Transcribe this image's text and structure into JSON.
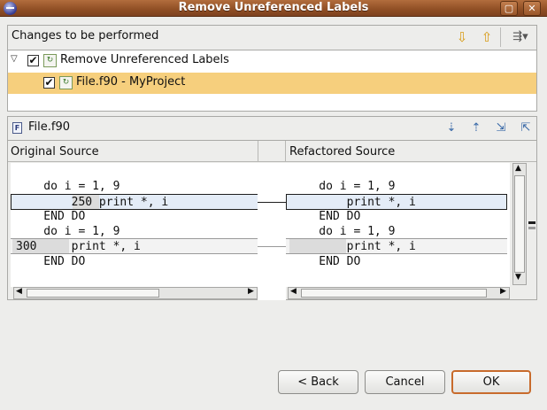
{
  "window": {
    "title": "Remove Unreferenced Labels"
  },
  "changes": {
    "header_label": "Changes to be performed",
    "tree": [
      {
        "label": "Remove Unreferenced Labels",
        "checked": "✔"
      },
      {
        "label": "File.f90 - MyProject",
        "checked": "✔"
      }
    ]
  },
  "preview": {
    "file_label": "File.f90",
    "original_header": "Original Source",
    "refactored_header": "Refactored Source",
    "original_lines": [
      "    do i = 1, 9",
      "        250 print *, i",
      "    END DO",
      "    do i = 1, 9",
      "300     print *, i",
      "    END DO"
    ],
    "refactored_lines": [
      "    do i = 1, 9",
      "        print *, i",
      "    END DO",
      "    do i = 1, 9",
      "        print *, i",
      "    END DO"
    ]
  },
  "buttons": {
    "back": "< Back",
    "cancel": "Cancel",
    "ok": "OK"
  }
}
